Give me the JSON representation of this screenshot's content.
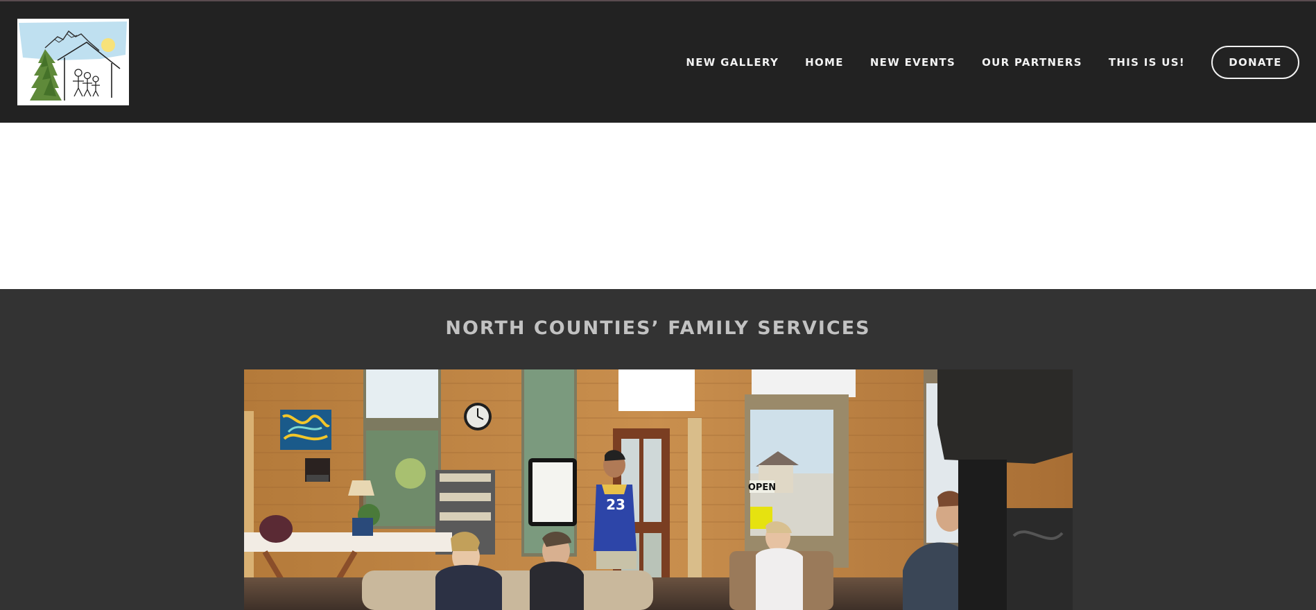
{
  "header": {
    "logo_alt": "North Counties' Family Services logo",
    "nav": [
      {
        "label": "NEW GALLERY"
      },
      {
        "label": "HOME"
      },
      {
        "label": "NEW EVENTS"
      },
      {
        "label": "OUR PARTNERS"
      },
      {
        "label": "THIS IS US!"
      }
    ],
    "donate_label": "DONATE"
  },
  "main": {
    "section_title": "NORTH COUNTIES’ FAMILY SERVICES",
    "photo": {
      "open_sign": "OPEN",
      "jersey_number": "23"
    }
  },
  "colors": {
    "header_bg": "#222222",
    "section_bg": "#333333",
    "title": "#c2c2c2",
    "nav_text": "#f2f2f2"
  }
}
